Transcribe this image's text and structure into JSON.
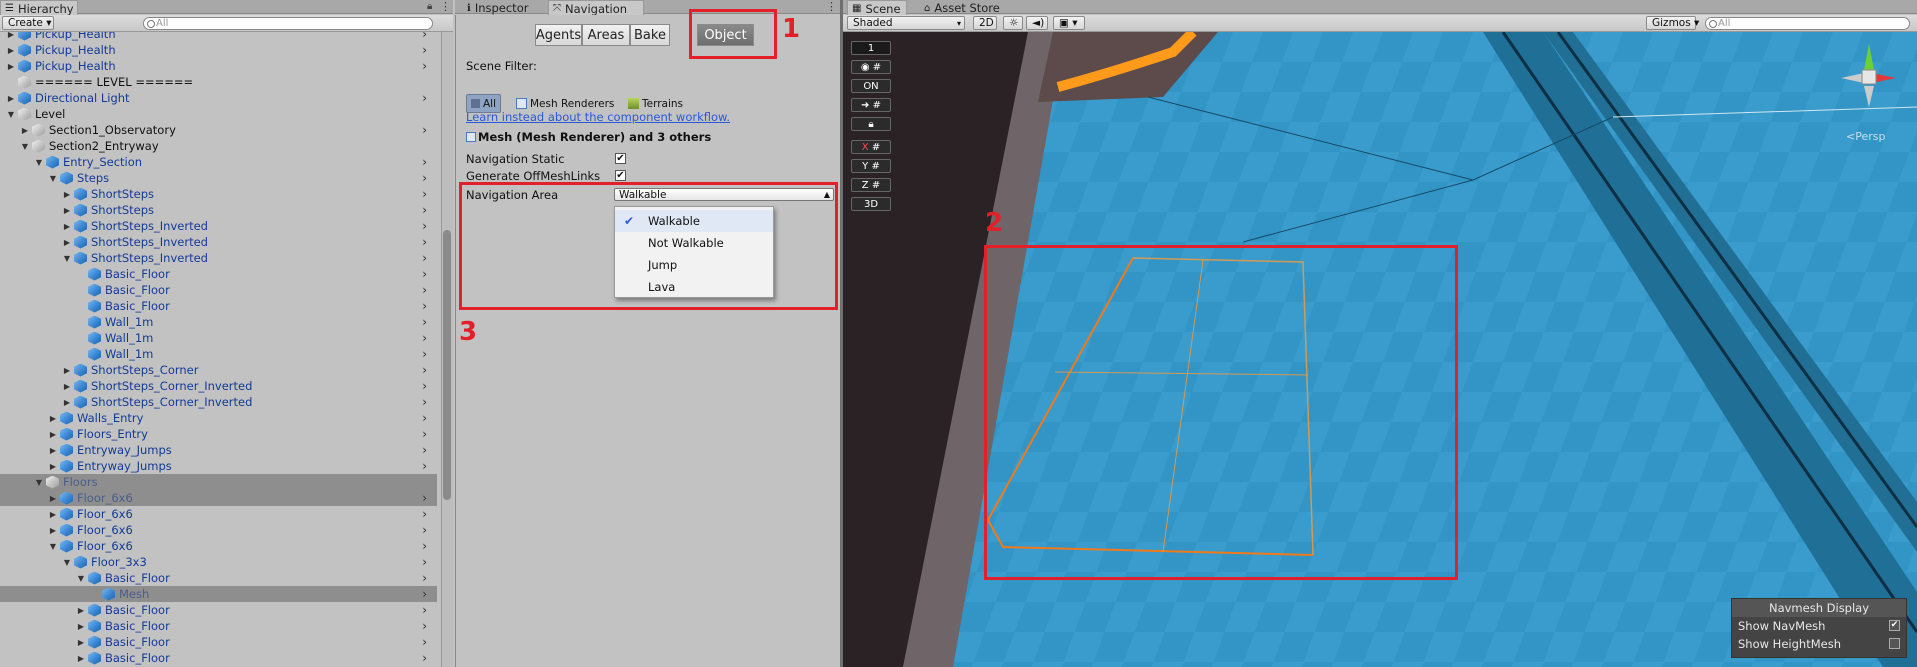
{
  "hierarchy": {
    "tab_label": "Hierarchy",
    "create_label": "Create",
    "search_placeholder": "All",
    "rows": [
      {
        "label": "Pickup_Health",
        "indent": 1,
        "arrow": "▶",
        "icon": "prefab-cube",
        "chevron": true
      },
      {
        "label": "Pickup_Health",
        "indent": 1,
        "arrow": "▶",
        "icon": "prefab-cube",
        "chevron": true
      },
      {
        "label": "Pickup_Health",
        "indent": 1,
        "arrow": "▶",
        "icon": "prefab-cube",
        "chevron": true
      },
      {
        "label": "====== LEVEL ======",
        "indent": 1,
        "arrow": "",
        "icon": "gameobject-cube",
        "chevron": false,
        "plain": true
      },
      {
        "label": "Directional Light",
        "indent": 1,
        "arrow": "▶",
        "icon": "prefab-cube",
        "chevron": true
      },
      {
        "label": "Level",
        "indent": 1,
        "arrow": "▼",
        "icon": "gameobject-cube",
        "chevron": false,
        "plain": true
      },
      {
        "label": "Section1_Observatory",
        "indent": 2,
        "arrow": "▶",
        "icon": "gameobject-cube",
        "chevron": true,
        "plain": true
      },
      {
        "label": "Section2_Entryway",
        "indent": 2,
        "arrow": "▼",
        "icon": "gameobject-cube",
        "chevron": false,
        "plain": true
      },
      {
        "label": "Entry_Section",
        "indent": 3,
        "arrow": "▼",
        "icon": "prefab-cube",
        "chevron": true
      },
      {
        "label": "Steps",
        "indent": 4,
        "arrow": "▼",
        "icon": "prefab-cube",
        "chevron": true
      },
      {
        "label": "ShortSteps",
        "indent": 5,
        "arrow": "▶",
        "icon": "prefab-cube",
        "chevron": true
      },
      {
        "label": "ShortSteps",
        "indent": 5,
        "arrow": "▶",
        "icon": "prefab-cube",
        "chevron": true
      },
      {
        "label": "ShortSteps_Inverted",
        "indent": 5,
        "arrow": "▶",
        "icon": "prefab-cube",
        "chevron": true
      },
      {
        "label": "ShortSteps_Inverted",
        "indent": 5,
        "arrow": "▶",
        "icon": "prefab-cube",
        "chevron": true
      },
      {
        "label": "ShortSteps_Inverted",
        "indent": 5,
        "arrow": "▼",
        "icon": "prefab-cube",
        "chevron": true
      },
      {
        "label": "Basic_Floor",
        "indent": 6,
        "arrow": "",
        "icon": "prefab-cube",
        "chevron": true
      },
      {
        "label": "Basic_Floor",
        "indent": 6,
        "arrow": "",
        "icon": "prefab-cube",
        "chevron": true
      },
      {
        "label": "Basic_Floor",
        "indent": 6,
        "arrow": "",
        "icon": "prefab-cube",
        "chevron": true
      },
      {
        "label": "Wall_1m",
        "indent": 6,
        "arrow": "",
        "icon": "prefab-cube",
        "chevron": true
      },
      {
        "label": "Wall_1m",
        "indent": 6,
        "arrow": "",
        "icon": "prefab-cube",
        "chevron": true
      },
      {
        "label": "Wall_1m",
        "indent": 6,
        "arrow": "",
        "icon": "prefab-cube",
        "chevron": true
      },
      {
        "label": "ShortSteps_Corner",
        "indent": 5,
        "arrow": "▶",
        "icon": "prefab-cube",
        "chevron": true
      },
      {
        "label": "ShortSteps_Corner_Inverted",
        "indent": 5,
        "arrow": "▶",
        "icon": "prefab-cube",
        "chevron": true
      },
      {
        "label": "ShortSteps_Corner_Inverted",
        "indent": 5,
        "arrow": "▶",
        "icon": "prefab-cube",
        "chevron": true
      },
      {
        "label": "Walls_Entry",
        "indent": 4,
        "arrow": "▶",
        "icon": "prefab-cube",
        "chevron": true
      },
      {
        "label": "Floors_Entry",
        "indent": 4,
        "arrow": "▶",
        "icon": "prefab-cube",
        "chevron": true
      },
      {
        "label": "Entryway_Jumps",
        "indent": 4,
        "arrow": "▶",
        "icon": "prefab-cube",
        "chevron": true
      },
      {
        "label": "Entryway_Jumps",
        "indent": 4,
        "arrow": "▶",
        "icon": "prefab-cube",
        "chevron": true
      },
      {
        "label": "Floors",
        "indent": 3,
        "arrow": "▼",
        "icon": "gameobject-cube",
        "chevron": false,
        "plain": true,
        "selected": true
      },
      {
        "label": "Floor_6x6",
        "indent": 4,
        "arrow": "▶",
        "icon": "prefab-cube",
        "chevron": true,
        "selected": true
      },
      {
        "label": "Floor_6x6",
        "indent": 4,
        "arrow": "▶",
        "icon": "prefab-cube",
        "chevron": true
      },
      {
        "label": "Floor_6x6",
        "indent": 4,
        "arrow": "▶",
        "icon": "prefab-cube",
        "chevron": true
      },
      {
        "label": "Floor_6x6",
        "indent": 4,
        "arrow": "▼",
        "icon": "prefab-cube",
        "chevron": true
      },
      {
        "label": "Floor_3x3",
        "indent": 5,
        "arrow": "▼",
        "icon": "prefab-cube",
        "chevron": true
      },
      {
        "label": "Basic_Floor",
        "indent": 6,
        "arrow": "▼",
        "icon": "prefab-cube",
        "chevron": true
      },
      {
        "label": "Mesh",
        "indent": 7,
        "arrow": "",
        "icon": "prefab-cube",
        "chevron": true,
        "selected": true
      },
      {
        "label": "Basic_Floor",
        "indent": 6,
        "arrow": "▶",
        "icon": "prefab-cube",
        "chevron": true
      },
      {
        "label": "Basic_Floor",
        "indent": 6,
        "arrow": "▶",
        "icon": "prefab-cube",
        "chevron": true
      },
      {
        "label": "Basic_Floor",
        "indent": 6,
        "arrow": "▶",
        "icon": "prefab-cube",
        "chevron": true
      },
      {
        "label": "Basic_Floor",
        "indent": 6,
        "arrow": "▶",
        "icon": "prefab-cube",
        "chevron": true
      }
    ]
  },
  "tabs": {
    "inspector": "Inspector",
    "navigation": "Navigation",
    "scene": "Scene",
    "asset_store": "Asset Store"
  },
  "navigation": {
    "segments": [
      "Agents",
      "Areas",
      "Bake",
      "Object"
    ],
    "active_segment": "Object",
    "scene_filter_label": "Scene Filter:",
    "filter_all": "All",
    "filter_mesh_renderers": "Mesh Renderers",
    "filter_terrains": "Terrains",
    "workflow_link": "Learn instead about the component workflow.",
    "object_title": "Mesh (Mesh Renderer) and 3 others",
    "nav_static_label": "Navigation Static",
    "nav_static_checked": true,
    "offmesh_label": "Generate OffMeshLinks",
    "offmesh_checked": true,
    "area_label": "Navigation Area",
    "area_value": "Walkable",
    "area_options": [
      "Walkable",
      "Not Walkable",
      "Jump",
      "Lava"
    ],
    "area_selected": "Walkable"
  },
  "annotations": {
    "one": "1",
    "two": "2",
    "three": "3",
    "color": "#e3202a"
  },
  "scene": {
    "shading": "Shaded",
    "mode_2d": "2D",
    "gizmos": "Gizmos",
    "search_placeholder": "All",
    "persp_label": "<Persp",
    "layer_value": "1",
    "toggle_on": "ON",
    "axis_x": "X",
    "axis_y": "Y",
    "axis_z": "Z",
    "mode_3d": "3D",
    "navmesh_display": {
      "title": "Navmesh Display",
      "show_navmesh": "Show NavMesh",
      "show_navmesh_checked": true,
      "show_heightmesh": "Show HeightMesh",
      "show_heightmesh_checked": false
    },
    "navmesh_color": "#2e8fbd"
  }
}
